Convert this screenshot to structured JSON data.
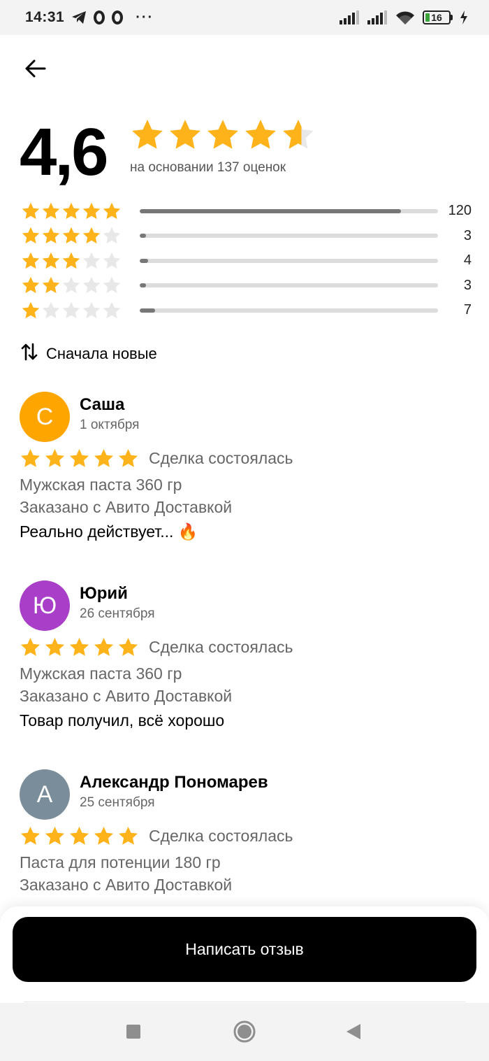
{
  "status_bar": {
    "time": "14:31",
    "icons": [
      "telegram-icon",
      "o-app-icon",
      "o-app-icon",
      "more-dots-icon",
      "signal-icon",
      "signal-icon",
      "wifi-icon",
      "battery-icon",
      "charging-icon"
    ],
    "dots": "···",
    "battery_level": "16"
  },
  "header": {
    "back_icon": "arrow-left-icon"
  },
  "summary": {
    "rating": "4,6",
    "rating_fraction": 0.92,
    "caption": "на основании 137 оценок",
    "distribution": [
      {
        "stars": 5,
        "count": "120",
        "share": 0.876
      },
      {
        "stars": 4,
        "count": "3",
        "share": 0.022
      },
      {
        "stars": 3,
        "count": "4",
        "share": 0.029
      },
      {
        "stars": 2,
        "count": "3",
        "share": 0.022
      },
      {
        "stars": 1,
        "count": "7",
        "share": 0.051
      }
    ]
  },
  "sort": {
    "icon": "sort-arrows-icon",
    "label": "Сначала новые"
  },
  "reviews": [
    {
      "initial": "С",
      "avatar_color": "#FFA500",
      "name": "Саша",
      "date": "1 октября",
      "stars": 5,
      "deal_status": "Сделка состоялась",
      "product": "Мужская паста 360 гр",
      "delivery": "Заказано с Авито Доставкой",
      "text": "Реально действует... 🔥"
    },
    {
      "initial": "Ю",
      "avatar_color": "#A93FC8",
      "name": "Юрий",
      "date": "26 сентября",
      "stars": 5,
      "deal_status": "Сделка состоялась",
      "product": "Мужская паста 360 гр",
      "delivery": "Заказано с Авито Доставкой",
      "text": "Товар получил, всё хорошо"
    },
    {
      "initial": "А",
      "avatar_color": "#7A8D9A",
      "name": "Александр Пономарев",
      "date": "25 сентября",
      "stars": 5,
      "deal_status": "Сделка состоялась",
      "product": "Паста для потенции 180 гр",
      "delivery": "Заказано с Авито Доставкой",
      "text": ""
    }
  ],
  "cta": {
    "label": "Написать отзыв"
  },
  "colors": {
    "star": "#FFB31A",
    "star_empty": "#E8E8E8",
    "bar_fill": "#777777",
    "bar_track": "#DCDCDC"
  },
  "nav": {
    "icons": [
      "recent-apps-icon",
      "home-icon",
      "back-nav-icon"
    ]
  }
}
